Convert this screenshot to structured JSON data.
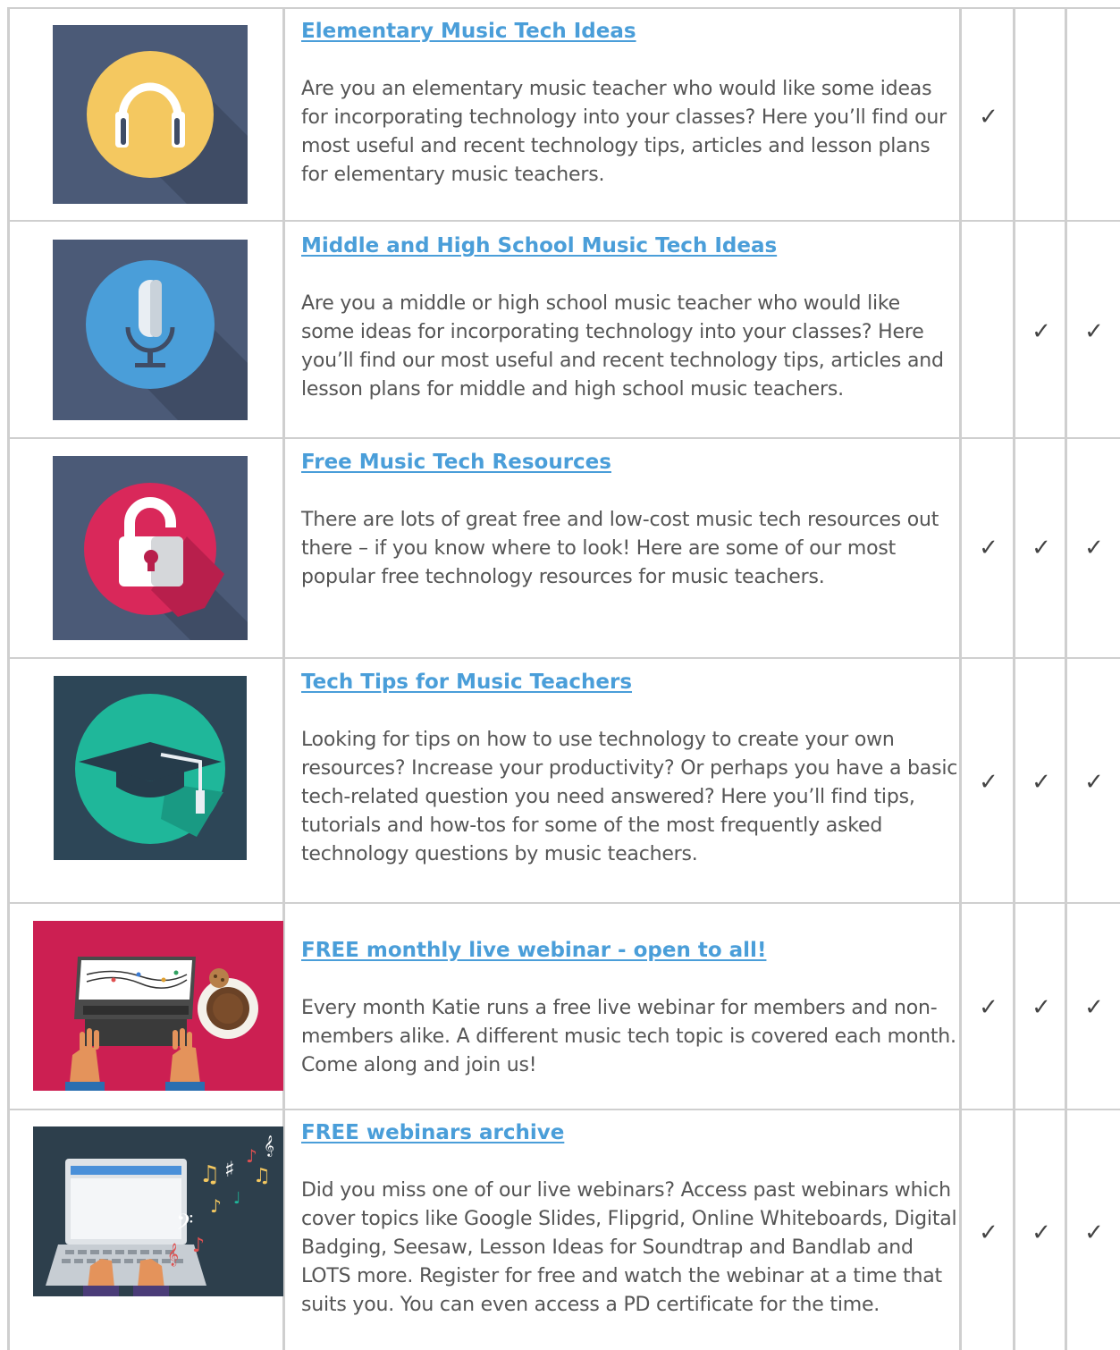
{
  "rows": [
    {
      "icon": "headphones-icon",
      "title": "Elementary Music Tech Ideas",
      "description": "Are you an elementary music teacher who would like some ideas for incorporating technology into your classes? Here you’ll find our most useful and recent technology tips, articles and lesson plans for elementary music teachers.",
      "checks": [
        true,
        false,
        false
      ]
    },
    {
      "icon": "microphone-icon",
      "title": "Middle and High School Music Tech Ideas",
      "description": "Are you a middle or high school music teacher who would like some ideas for incorporating technology into your classes? Here you’ll find our most useful and recent technology tips, articles and lesson plans for middle and high school music teachers.",
      "checks": [
        false,
        true,
        true
      ]
    },
    {
      "icon": "padlock-icon",
      "title": "Free Music Tech Resources",
      "description": "There are lots of great free and low-cost music tech resources out there – if you know where to look! Here are some of our most popular free technology resources for music teachers.",
      "checks": [
        true,
        true,
        true
      ]
    },
    {
      "icon": "graduation-cap-icon",
      "title": "Tech Tips for Music Teachers",
      "description": "Looking for tips on how to use technology to create your own resources? Increase your productivity? Or perhaps you have a basic tech-related question you need answered? Here you’ll find tips, tutorials and how-tos for some of the most frequently asked technology questions by music teachers.",
      "checks": [
        true,
        true,
        true
      ]
    },
    {
      "icon": "laptop-coffee-illustration",
      "title": "FREE monthly live webinar - open to all!",
      "description": "Every month Katie runs a free live webinar for members and non-members alike. A different music tech topic is covered each month. Come along and join us!",
      "checks": [
        true,
        true,
        true
      ]
    },
    {
      "icon": "laptop-music-notes-illustration",
      "title": "FREE webinars archive",
      "description": "Did you miss one of our live webinars? Access past webinars which cover topics like Google Slides, Flipgrid, Online Whiteboards, Digital Badging, Seesaw, Lesson Ideas for Soundtrap and Bandlab and LOTS more. Register for free and watch the webinar at a time that suits you. You can even access a PD certificate for the time.",
      "checks": [
        true,
        true,
        true
      ]
    }
  ],
  "check_symbol": "✓",
  "colors": {
    "link": "#4a9ed9",
    "text": "#555555",
    "border": "#cfcfcf",
    "slate": "#4b5a77",
    "headphones_yellow": "#f4c860",
    "mic_blue": "#4a9ed9",
    "lock_red": "#d9285a",
    "cap_teal": "#1fb79a",
    "cap_bg": "#2d4657",
    "webinar_pink": "#cc1f52",
    "archive_bg": "#2d3f4c"
  }
}
